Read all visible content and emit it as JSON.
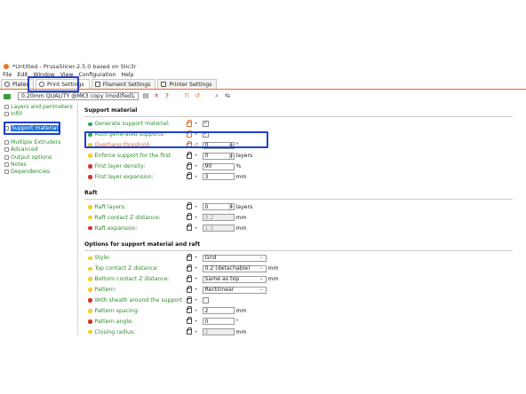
{
  "window": {
    "title": "*Untitled - PrusaSlicer-2.5.0 based on Slic3r"
  },
  "menu": [
    "File",
    "Edit",
    "Window",
    "View",
    "Configuration",
    "Help"
  ],
  "tabs": [
    {
      "label": "Plater",
      "icon": "plater-icon"
    },
    {
      "label": "Print Settings",
      "icon": "gear-icon",
      "active": true
    },
    {
      "label": "Filament Settings",
      "icon": "spool-icon"
    },
    {
      "label": "Printer Settings",
      "icon": "printer-icon"
    }
  ],
  "preset": {
    "value": "0.20mm QUALITY @MK3 copy (modified)"
  },
  "sidebar": [
    {
      "label": "Layers and perimeters"
    },
    {
      "label": "Infill"
    },
    {
      "label": "Support material",
      "selected": true
    },
    {
      "label": ""
    },
    {
      "label": "Multiple Extruders"
    },
    {
      "label": "Advanced"
    },
    {
      "label": "Output options"
    },
    {
      "label": "Notes"
    },
    {
      "label": "Dependencies"
    }
  ],
  "sections": {
    "support": {
      "title": "Support material",
      "rows": {
        "generate": {
          "label": "Generate support material:"
        },
        "auto": {
          "label": "Auto generated supports:"
        },
        "overhang": {
          "label": "Overhang threshold:",
          "value": "0",
          "unit": "°"
        },
        "enforce": {
          "label": "Enforce support for the first",
          "value": "0",
          "unit": "layers"
        },
        "density": {
          "label": "First layer density:",
          "value": "90",
          "unit": "%"
        },
        "expansion": {
          "label": "First layer expansion:",
          "value": "3",
          "unit": "mm"
        }
      }
    },
    "raft": {
      "title": "Raft",
      "rows": {
        "layers": {
          "label": "Raft layers:",
          "value": "0",
          "unit": "layers"
        },
        "contact": {
          "label": "Raft contact Z distance:",
          "value": "0.2",
          "unit": "mm"
        },
        "expansion": {
          "label": "Raft expansion:",
          "value": "1.5",
          "unit": "mm"
        }
      }
    },
    "options": {
      "title": "Options for support material and raft",
      "rows": {
        "style": {
          "label": "Style:",
          "value": "Grid"
        },
        "topz": {
          "label": "Top contact Z distance:",
          "value": "0.2 (detachable)",
          "unit": "mm"
        },
        "bottomz": {
          "label": "Bottom contact Z distance:",
          "value": "Same as top",
          "unit": "mm"
        },
        "pattern": {
          "label": "Pattern:",
          "value": "Rectilinear"
        },
        "sheath": {
          "label": "With sheath around the support:"
        },
        "spacing": {
          "label": "Pattern spacing:",
          "value": "2",
          "unit": "mm"
        },
        "angle": {
          "label": "Pattern angle:",
          "value": "0",
          "unit": "°"
        },
        "closing": {
          "label": "Closing radius:",
          "value": "2",
          "unit": "mm"
        }
      }
    }
  },
  "colors": {
    "accent": "#ed6b21",
    "highlight": "#1f3fd6",
    "selection": "#1e6fd9"
  }
}
